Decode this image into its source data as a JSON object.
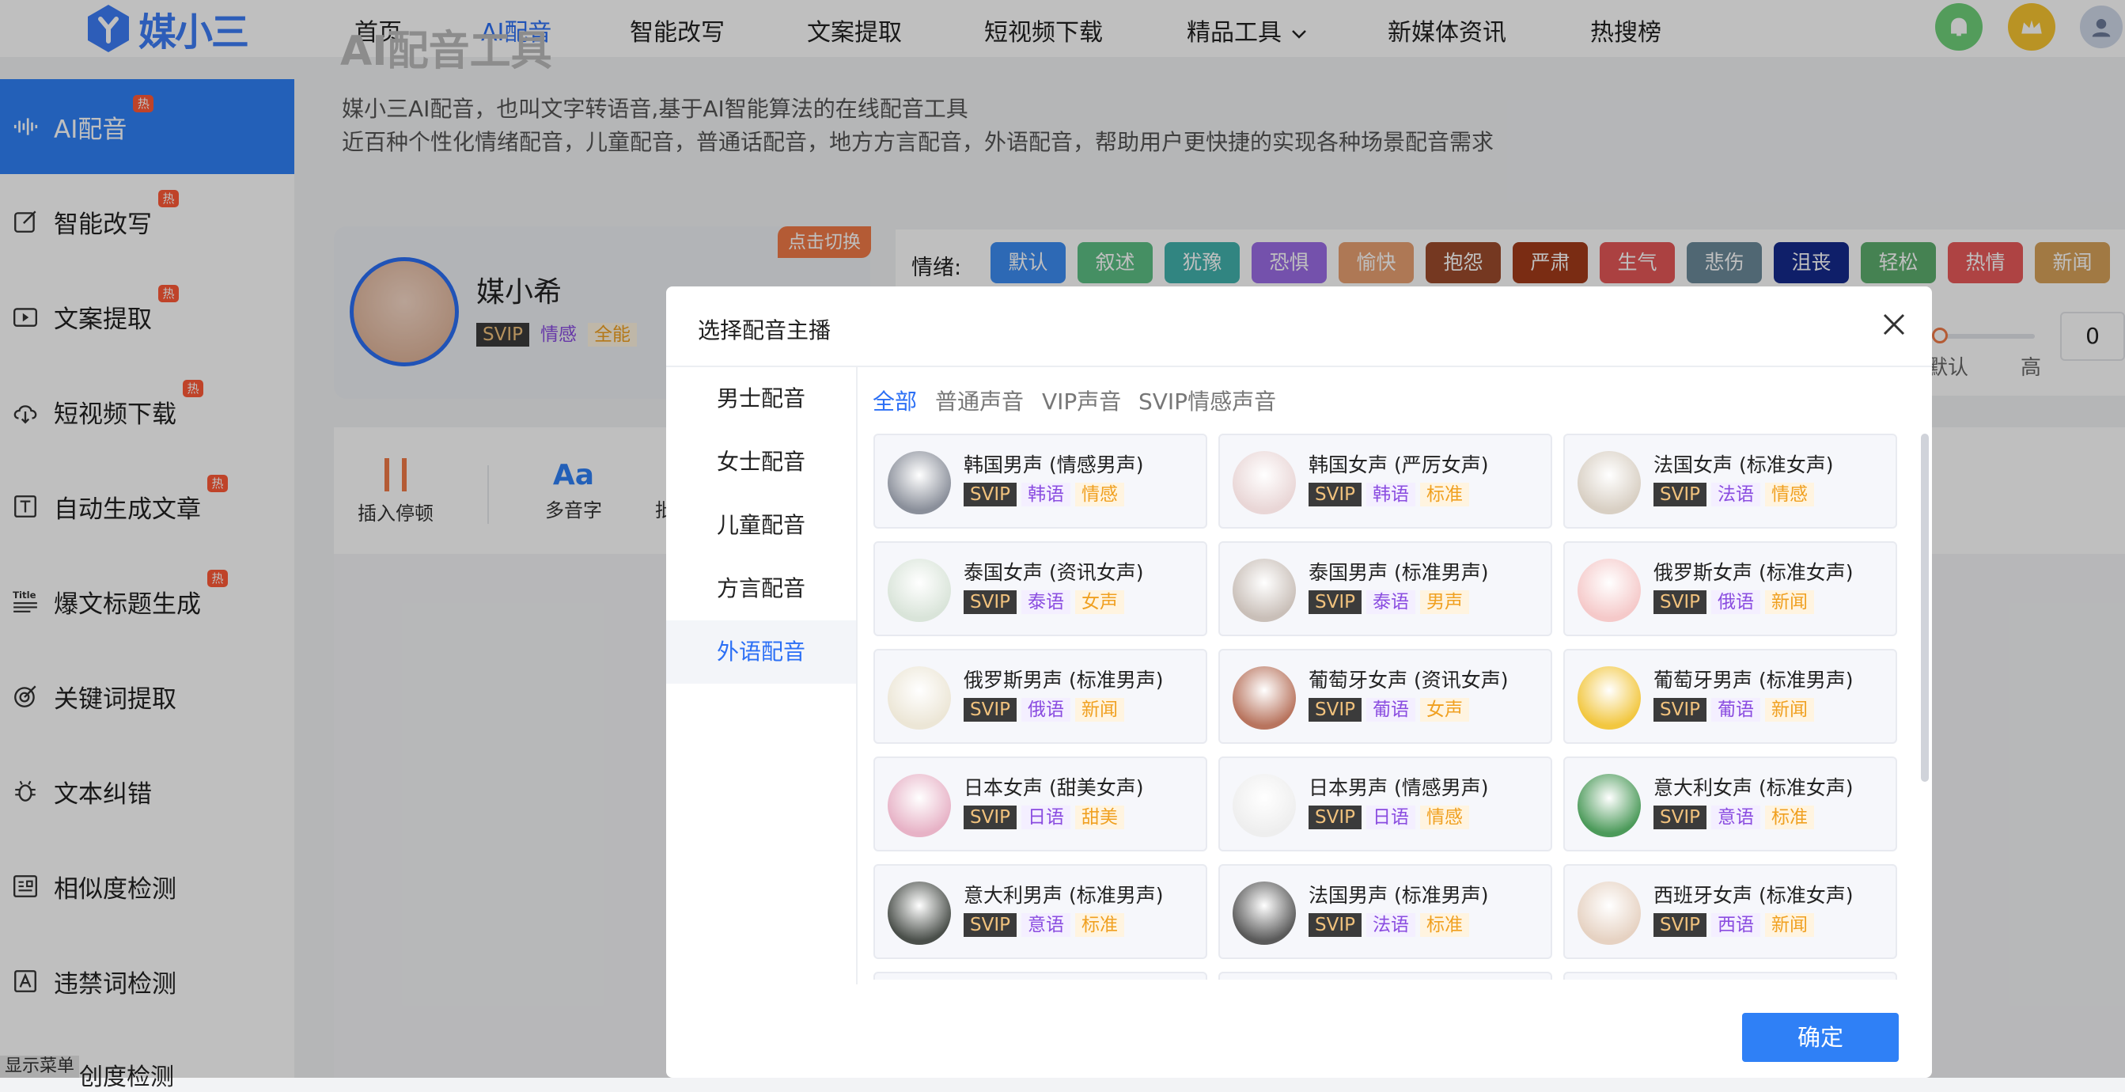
{
  "brand": {
    "logo_text": "媒小三"
  },
  "nav": {
    "items": [
      {
        "label": "首页"
      },
      {
        "label": "AI配音"
      },
      {
        "label": "智能改写"
      },
      {
        "label": "文案提取"
      },
      {
        "label": "短视频下载"
      },
      {
        "label": "精品工具"
      },
      {
        "label": "新媒体资讯"
      },
      {
        "label": "热搜榜"
      }
    ]
  },
  "sidebar": {
    "hot_badge": "热",
    "items": [
      {
        "label": "AI配音",
        "icon": "waveform-icon"
      },
      {
        "label": "智能改写",
        "icon": "edit-icon"
      },
      {
        "label": "文案提取",
        "icon": "video-icon"
      },
      {
        "label": "短视频下载",
        "icon": "cloud-download-icon"
      },
      {
        "label": "自动生成文章",
        "icon": "text-t-icon"
      },
      {
        "label": "爆文标题生成",
        "icon": "title-icon"
      },
      {
        "label": "关键词提取",
        "icon": "target-icon"
      },
      {
        "label": "文本纠错",
        "icon": "bug-icon"
      },
      {
        "label": "相似度检测",
        "icon": "doc-compare-icon"
      },
      {
        "label": "违禁词检测",
        "icon": "doc-a-icon"
      }
    ],
    "show_menu": "显示菜单",
    "partial_item": "创度检测"
  },
  "page": {
    "title": "AI配音工具",
    "desc1": "媒小三AI配音，也叫文字转语音,基于AI智能算法的在线配音工具",
    "desc2": "近百种个性化情绪配音，儿童配音，普通话配音，地方方言配音，外语配音，帮助用户更快捷的实现各种场景配音需求"
  },
  "anchor": {
    "switch_label": "点击切换",
    "name": "媒小希",
    "tags": [
      "SVIP",
      "情感",
      "全能"
    ]
  },
  "emotion": {
    "label": "情绪:",
    "buttons": [
      {
        "label": "默认",
        "color": "#3c8cf2"
      },
      {
        "label": "叙述",
        "color": "#5cbf84"
      },
      {
        "label": "犹豫",
        "color": "#42b2ad"
      },
      {
        "label": "恐惧",
        "color": "#9b6ce6"
      },
      {
        "label": "愉快",
        "color": "#e8a072"
      },
      {
        "label": "抱怨",
        "color": "#9c4b2c"
      },
      {
        "label": "严肃",
        "color": "#a33b1a"
      },
      {
        "label": "生气",
        "color": "#e45757"
      },
      {
        "label": "悲伤",
        "color": "#6b8a9a"
      },
      {
        "label": "沮丧",
        "color": "#142a8c"
      },
      {
        "label": "轻松",
        "color": "#5cae6e"
      },
      {
        "label": "热情",
        "color": "#e85a5a"
      },
      {
        "label": "新闻",
        "color": "#d7a25a"
      }
    ]
  },
  "speed": {
    "low_label": "默认",
    "high_label": "高",
    "value": "0"
  },
  "toolbar": {
    "pause_label": "插入停顿",
    "polyphone_icon": "Aa",
    "polyphone_label": "多音字",
    "partial_label": "批"
  },
  "dialog": {
    "title": "选择配音主播",
    "categories": [
      "男士配音",
      "女士配音",
      "儿童配音",
      "方言配音",
      "外语配音"
    ],
    "active_category": 4,
    "subtabs": [
      "全部",
      "普通声音",
      "VIP声音",
      "SVIP情感声音"
    ],
    "voices": [
      {
        "name": "韩国男声 (情感男声)",
        "tags": [
          "SVIP",
          "韩语",
          "情感"
        ],
        "bg": "#8a8f9a"
      },
      {
        "name": "韩国女声 (严厉女声)",
        "tags": [
          "SVIP",
          "韩语",
          "标准"
        ],
        "bg": "#e9d6d6"
      },
      {
        "name": "法国女声 (标准女声)",
        "tags": [
          "SVIP",
          "法语",
          "情感"
        ],
        "bg": "#d8cfc3"
      },
      {
        "name": "泰国女声 (资讯女声)",
        "tags": [
          "SVIP",
          "泰语",
          "女声"
        ],
        "bg": "#d9e4d9"
      },
      {
        "name": "泰国男声 (标准男声)",
        "tags": [
          "SVIP",
          "泰语",
          "男声"
        ],
        "bg": "#c9bfb8"
      },
      {
        "name": "俄罗斯女声 (标准女声)",
        "tags": [
          "SVIP",
          "俄语",
          "新闻"
        ],
        "bg": "#f5c9c9"
      },
      {
        "name": "俄罗斯男声 (标准男声)",
        "tags": [
          "SVIP",
          "俄语",
          "新闻"
        ],
        "bg": "#ece6d6"
      },
      {
        "name": "葡萄牙女声 (资讯女声)",
        "tags": [
          "SVIP",
          "葡语",
          "女声"
        ],
        "bg": "#b8745e"
      },
      {
        "name": "葡萄牙男声 (标准男声)",
        "tags": [
          "SVIP",
          "葡语",
          "新闻"
        ],
        "bg": "#f2c740"
      },
      {
        "name": "日本女声 (甜美女声)",
        "tags": [
          "SVIP",
          "日语",
          "甜美"
        ],
        "bg": "#e7b2c6"
      },
      {
        "name": "日本男声 (情感男声)",
        "tags": [
          "SVIP",
          "日语",
          "情感"
        ],
        "bg": "#eeeeee"
      },
      {
        "name": "意大利女声 (标准女声)",
        "tags": [
          "SVIP",
          "意语",
          "标准"
        ],
        "bg": "#4c9a5a"
      },
      {
        "name": "意大利男声 (标准男声)",
        "tags": [
          "SVIP",
          "意语",
          "标准"
        ],
        "bg": "#4a4f4a"
      },
      {
        "name": "法国男声 (标准男声)",
        "tags": [
          "SVIP",
          "法语",
          "标准"
        ],
        "bg": "#5a5a5a"
      },
      {
        "name": "西班牙女声 (标准女声)",
        "tags": [
          "SVIP",
          "西语",
          "新闻"
        ],
        "bg": "#e6d2c2"
      }
    ],
    "confirm_label": "确定"
  },
  "colors": {
    "accent": "#2f80f6",
    "hot": "#ff5a37",
    "svip_bg": "#3b3b3b",
    "svip_text": "#f1c27d"
  }
}
